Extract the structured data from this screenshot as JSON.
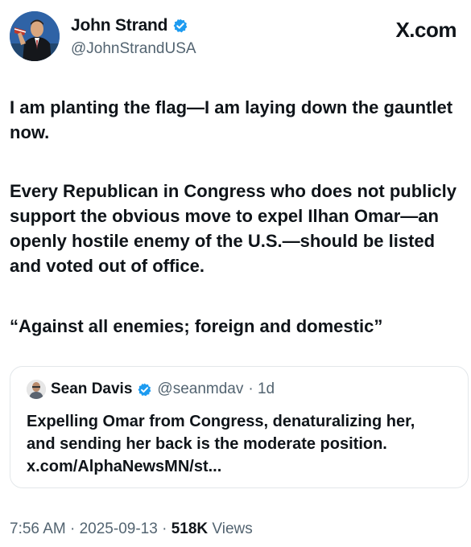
{
  "author": {
    "name": "John Strand",
    "handle": "@JohnStrandUSA",
    "verified": true,
    "avatar_icon": "profile-photo"
  },
  "brand": "X.com",
  "tweet": {
    "paragraphs": [
      "I am planting the flag—I am laying down the gauntlet now.",
      "Every Republican in Congress who does not publicly support the obvious move to expel Ilhan Omar—an openly hostile enemy of the U.S.—should be listed and voted out of office.",
      "“Against all enemies; foreign and domestic”"
    ]
  },
  "quote": {
    "name": "Sean Davis",
    "handle": "@seanmdav",
    "age": "· 1d",
    "verified": true,
    "text": "Expelling Omar from Congress, denaturalizing her, and sending her back is the moderate position. x.com/AlphaNewsMN/st..."
  },
  "meta": {
    "time": "7:56 AM",
    "date": "2025-09-13",
    "views_count": "518K",
    "views_label": "Views",
    "separator": "·"
  },
  "colors": {
    "verified": "#1d9bf0",
    "secondary_text": "#536471",
    "primary_text": "#0f1419"
  }
}
